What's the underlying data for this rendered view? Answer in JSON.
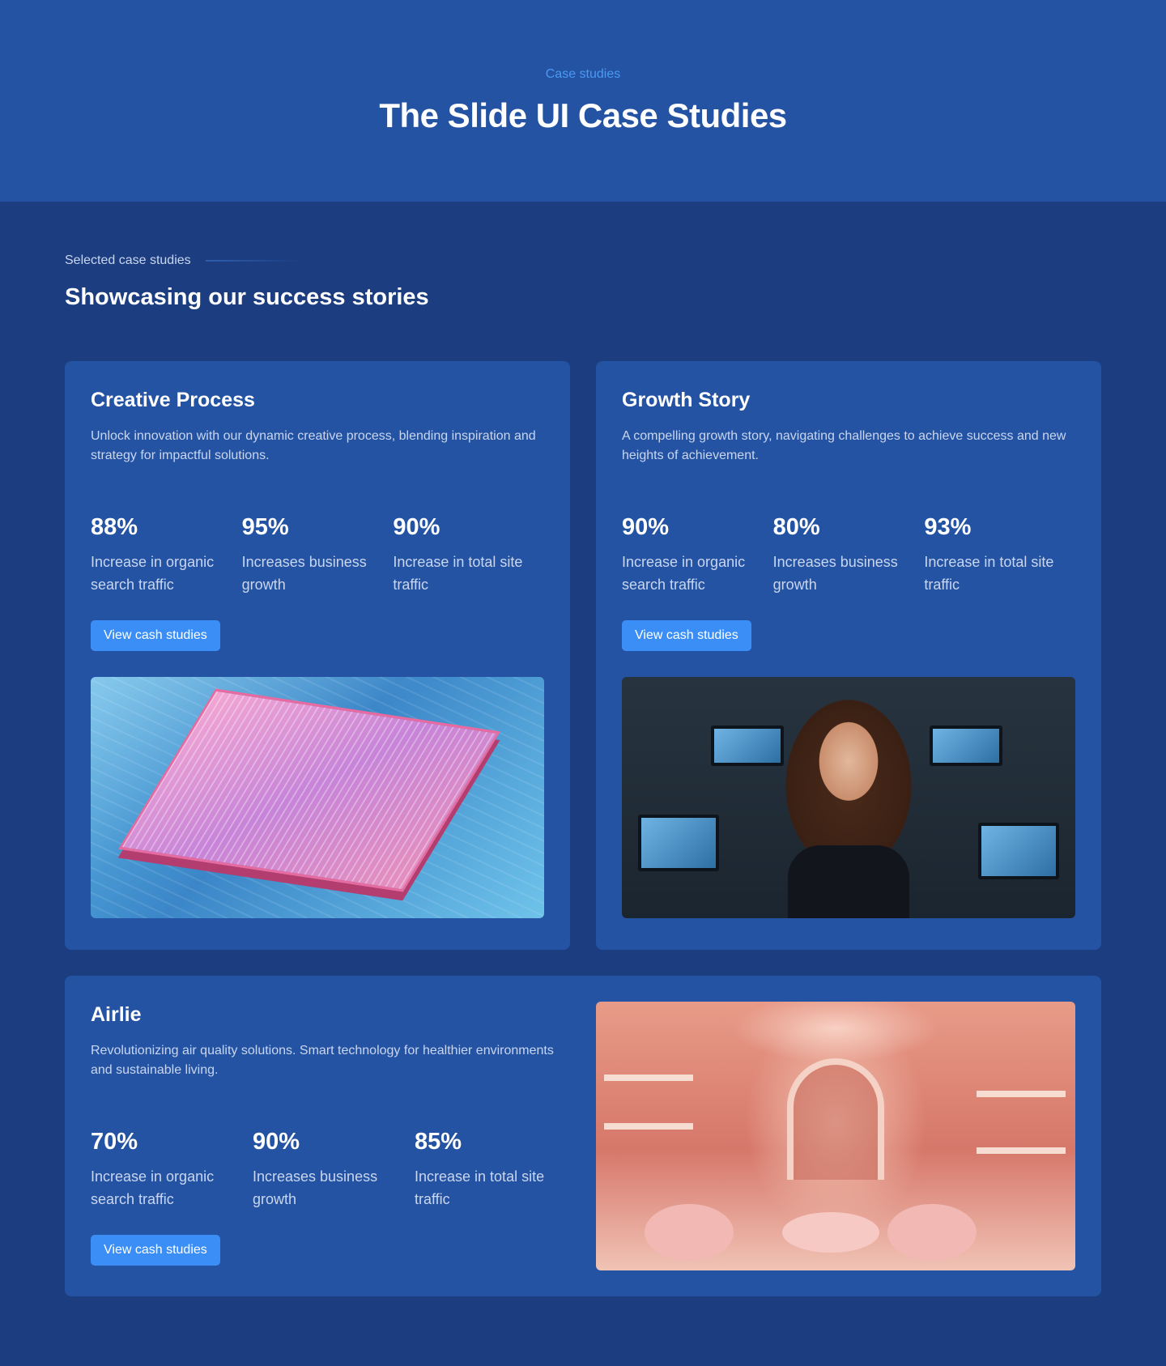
{
  "hero": {
    "eyebrow": "Case studies",
    "title": "The Slide UI Case Studies"
  },
  "section": {
    "eyebrow": "Selected case studies",
    "title": "Showcasing our success stories"
  },
  "cards": [
    {
      "title": "Creative Process",
      "description": "Unlock innovation with our dynamic creative process, blending inspiration and strategy for impactful solutions.",
      "stats": [
        {
          "value": "88%",
          "label": "Increase in organic search traffic"
        },
        {
          "value": "95%",
          "label": "Increases business growth"
        },
        {
          "value": "90%",
          "label": "Increase in total site traffic"
        }
      ],
      "button": "View cash studies",
      "image": "circuit-chip-image"
    },
    {
      "title": "Growth Story",
      "description": "A compelling growth story, navigating challenges to achieve success and new heights of achievement.",
      "stats": [
        {
          "value": "90%",
          "label": "Increase in organic search traffic"
        },
        {
          "value": "80%",
          "label": "Increases business growth"
        },
        {
          "value": "93%",
          "label": "Increase in total site traffic"
        }
      ],
      "button": "View cash studies",
      "image": "businesswoman-office-image"
    },
    {
      "title": "Airlie",
      "description": "Revolutionizing air quality solutions. Smart technology for healthier environments and sustainable living.",
      "stats": [
        {
          "value": "70%",
          "label": "Increase in organic search traffic"
        },
        {
          "value": "90%",
          "label": "Increases business growth"
        },
        {
          "value": "85%",
          "label": "Increase in total site traffic"
        }
      ],
      "button": "View cash studies",
      "image": "pink-boutique-image"
    }
  ],
  "colors": {
    "hero_bg": "#2453a3",
    "page_bg": "#1c3d80",
    "card_bg": "#2453a3",
    "accent": "#3a8ef6",
    "eyebrow": "#4a9af2"
  }
}
